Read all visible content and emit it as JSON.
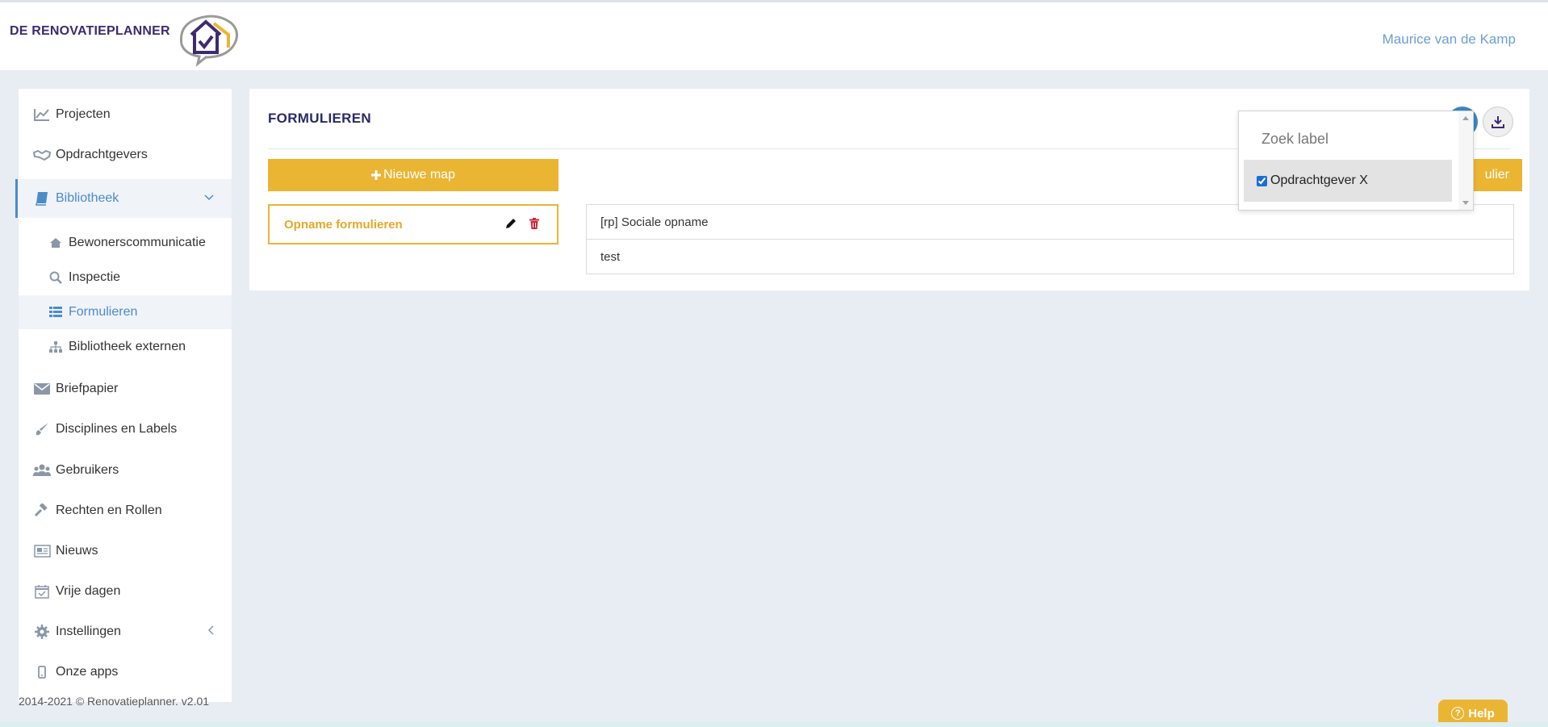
{
  "header": {
    "logo_text": "DE RENOVATIEPLANNER",
    "user_name": "Maurice van de Kamp"
  },
  "sidebar": {
    "items": [
      {
        "label": "Projecten",
        "icon": "line-chart-icon"
      },
      {
        "label": "Opdrachtgevers",
        "icon": "handshake-icon"
      },
      {
        "label": "Bibliotheek",
        "icon": "book-icon",
        "active": true
      },
      {
        "label": "Briefpapier",
        "icon": "envelope-icon"
      },
      {
        "label": "Disciplines en Labels",
        "icon": "brush-icon"
      },
      {
        "label": "Gebruikers",
        "icon": "users-icon"
      },
      {
        "label": "Rechten en Rollen",
        "icon": "gavel-icon"
      },
      {
        "label": "Nieuws",
        "icon": "newspaper-icon"
      },
      {
        "label": "Vrije dagen",
        "icon": "calendar-check-icon"
      },
      {
        "label": "Instellingen",
        "icon": "gear-icon"
      },
      {
        "label": "Onze apps",
        "icon": "mobile-icon"
      }
    ],
    "sub_items": [
      {
        "label": "Bewonerscommunicatie",
        "icon": "home-icon"
      },
      {
        "label": "Inspectie",
        "icon": "search-icon"
      },
      {
        "label": "Formulieren",
        "icon": "list-icon",
        "active": true
      },
      {
        "label": "Bibliotheek externen",
        "icon": "sitemap-icon"
      }
    ]
  },
  "main": {
    "title": "FORMULIEREN",
    "new_folder_button": "Nieuwe map",
    "new_form_button_partial": "ulier",
    "folders": [
      {
        "label": "Opname formulieren"
      }
    ],
    "forms": [
      {
        "label": "[rp] Sociale opname"
      },
      {
        "label": "test"
      }
    ]
  },
  "label_dropdown": {
    "search_placeholder": "Zoek label",
    "options": [
      {
        "label": "Opdrachtgever X",
        "checked": true
      }
    ]
  },
  "footer": {
    "text": "2014-2021 © Renovatieplanner. v2.01"
  },
  "help_button": "Help",
  "colors": {
    "accent_yellow": "#ebb534",
    "accent_blue": "#4a8cc9",
    "brand_purple": "#3d2a70",
    "background": "#e8ecf3"
  }
}
